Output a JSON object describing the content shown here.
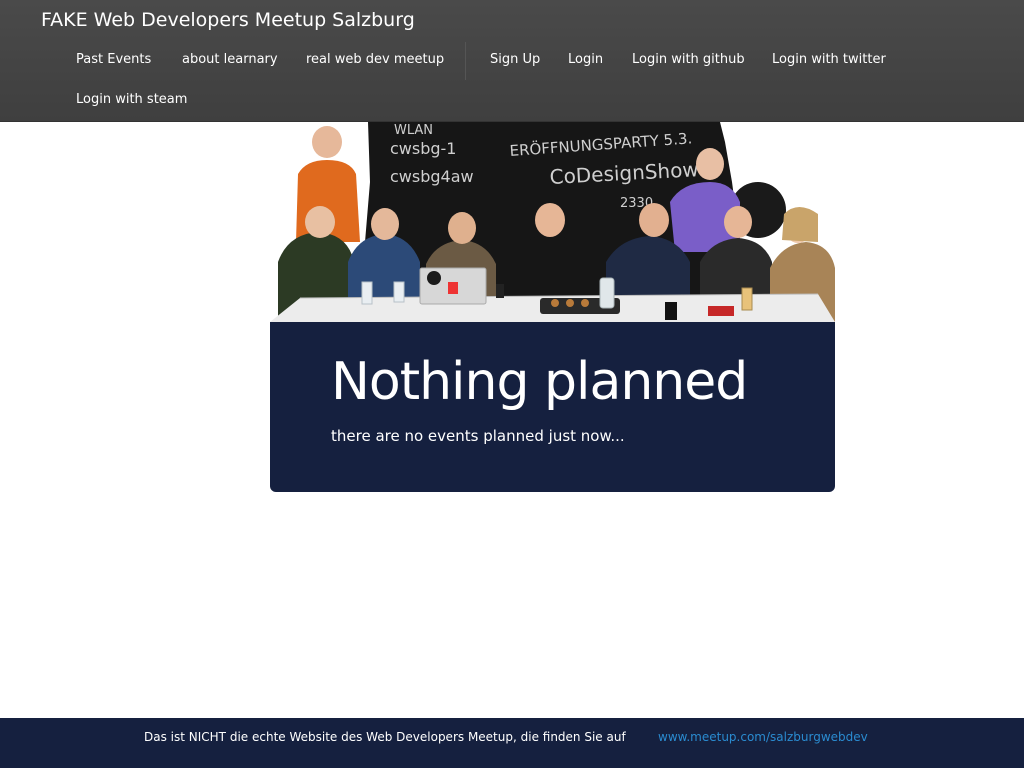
{
  "navbar": {
    "brand": "FAKE Web Developers Meetup Salzburg",
    "links": [
      {
        "label": "Past Events"
      },
      {
        "label": "about learnary"
      },
      {
        "label": "real web dev meetup"
      },
      {
        "label": "Sign Up"
      },
      {
        "label": "Login"
      },
      {
        "label": "Login with github"
      },
      {
        "label": "Login with twitter"
      },
      {
        "label": "Login with steam"
      }
    ]
  },
  "hero": {
    "chalk_lines": [
      "WLAN",
      "cwsbg-1",
      "cwsbg4aw",
      "ERÖFFNUNGSPARTY 5.3.",
      "CoDesignShow",
      "2330"
    ]
  },
  "jumbotron": {
    "title": "Nothing planned",
    "subtitle": "there are no events planned just now..."
  },
  "footer": {
    "text": "Das ist NICHT die echte Website des Web Developers Meetup, die finden Sie auf",
    "link": "www.meetup.com/salzburgwebdev"
  },
  "colors": {
    "navbar": "#444444",
    "jumbotron": "#15203f",
    "footer": "#15203f",
    "link": "#2a8bd0"
  }
}
